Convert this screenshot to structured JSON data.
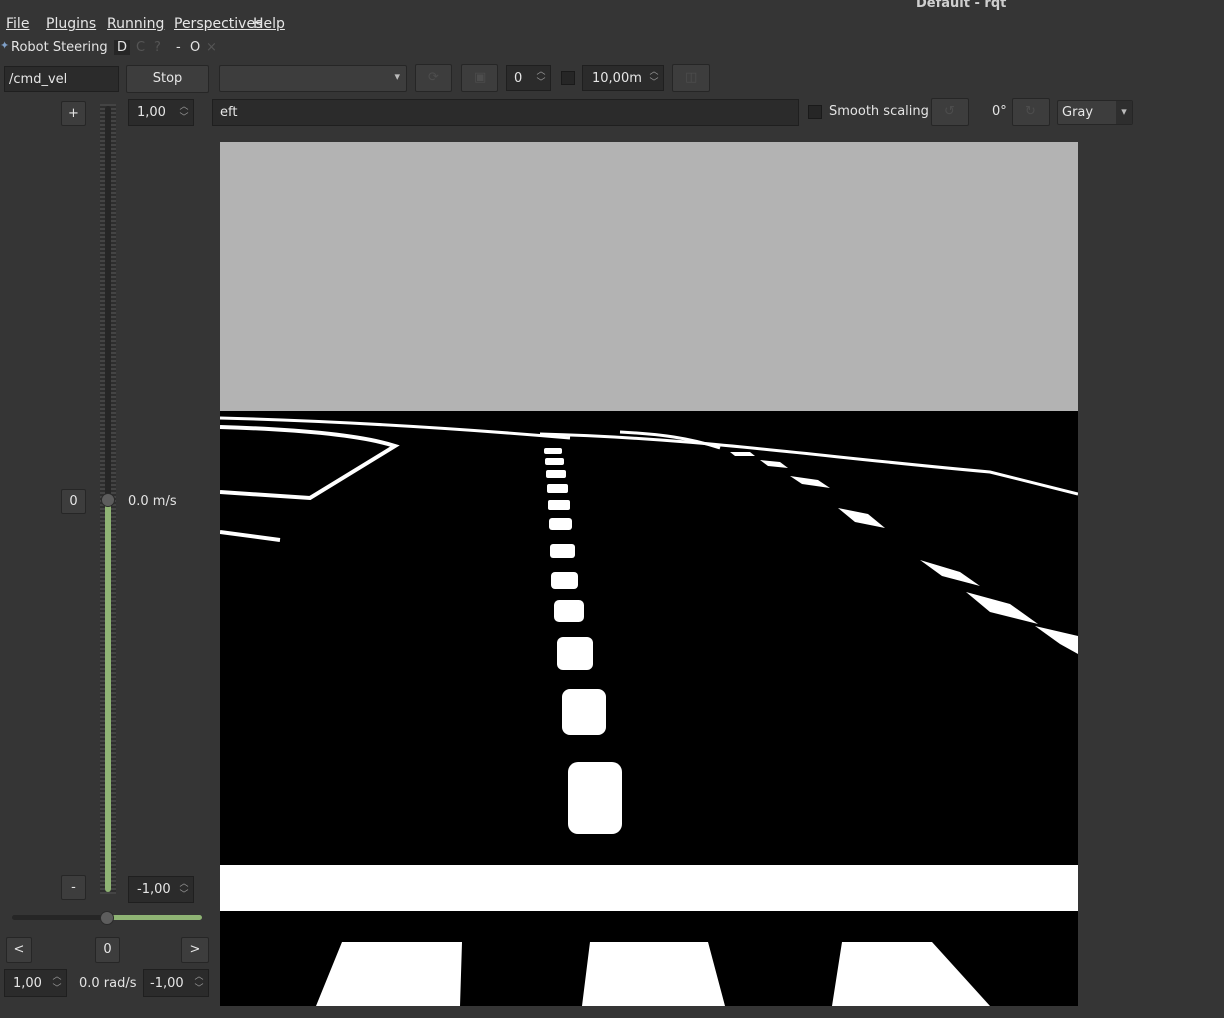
{
  "window": {
    "title": "Default - rqt"
  },
  "menubar": {
    "items": [
      "File",
      "Plugins",
      "Running",
      "Perspectives",
      "Help"
    ]
  },
  "plugin_tab": {
    "title": "Robot Steering",
    "controls": [
      "D",
      "C",
      "?",
      "-",
      "O",
      "×"
    ]
  },
  "steering": {
    "topic": "/cmd_vel",
    "stop_label": "Stop",
    "plus_label": "+",
    "zero_label": "0",
    "minus_label": "-",
    "max_linear": "1,00",
    "min_linear": "-1,00",
    "linear_value": 0.0,
    "linear_readout": "0.0 m/s",
    "left_label": "<",
    "center_label": "0",
    "right_label": ">",
    "max_angular": "1,00",
    "min_angular": "-1,00",
    "angular_value": 0.0,
    "angular_readout": "0.0 rad/s"
  },
  "image_view": {
    "topic_dropdown": "",
    "zoom_spin": "0",
    "timeout_spin": "10,00m",
    "topic_text": "eft",
    "smooth_scaling_label": "Smooth scaling",
    "rotation_label": "0°",
    "colormap": "Gray"
  },
  "colors": {
    "accent": "#8fb474",
    "background": "#353535",
    "sky": "#b3b3b3"
  }
}
